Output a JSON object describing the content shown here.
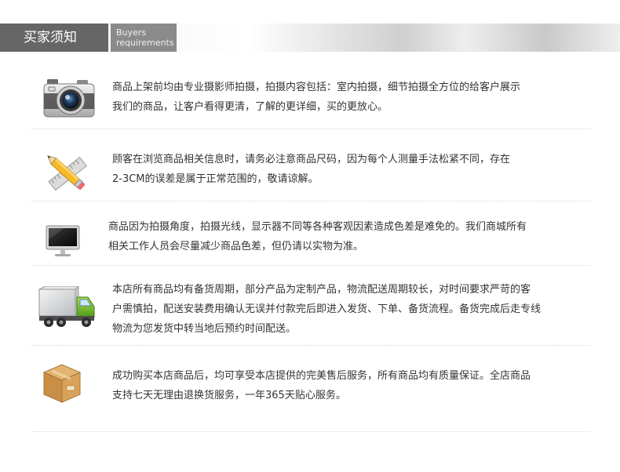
{
  "header": {
    "title": "买家须知",
    "subtitle_line1": "Buyers",
    "subtitle_line2": "requirements"
  },
  "items": [
    {
      "icon": "camera-icon",
      "lines": [
        "商品上架前均由专业摄影师拍摄，拍摄内容包括：室内拍摄，细节拍摄全方位的给客户展示",
        "我们的商品，让客户看得更清，了解的更详细，买的更放心。"
      ]
    },
    {
      "icon": "pencil-ruler-icon",
      "lines": [
        "顾客在浏览商品相关信息时，请务必注意商品尺码，因为每个人测量手法松紧不同，存在",
        "2-3CM的误差是属于正常范围的，敬请谅解。"
      ]
    },
    {
      "icon": "monitor-icon",
      "lines": [
        "商品因为拍摄角度，拍摄光线，显示器不同等各种客观因素造成色差是难免的。我们商城所有",
        "相关工作人员会尽量减少商品色差，但仍请以实物为准。"
      ]
    },
    {
      "icon": "delivery-truck-icon",
      "lines": [
        "本店所有商品均有备货周期，部分产品为定制产品，物流配送周期较长，对时间要求严苛的客",
        "户需慎拍，配送安装费用确认无误并付款完后即进入发货、下单、备货流程。备货完成后走专线",
        "物流为您发货中转当地后预约时间配送。"
      ]
    },
    {
      "icon": "cardboard-box-icon",
      "lines": [
        "成功购买本店商品后，均可享受本店提供的完美售后服务，所有商品均有质量保证。全店商品",
        "支持七天无理由退换货服务，一年365天贴心服务。"
      ]
    }
  ]
}
